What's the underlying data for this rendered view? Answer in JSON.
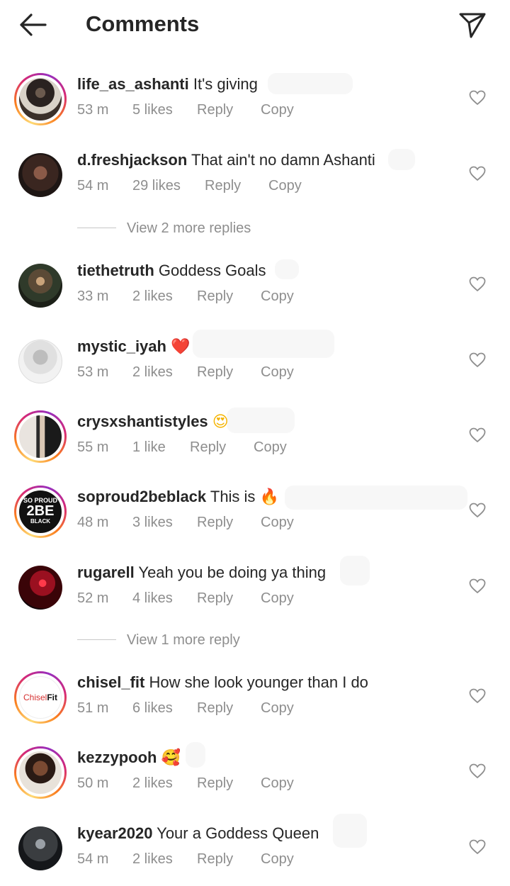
{
  "header": {
    "title": "Comments"
  },
  "comments": [
    {
      "username": "life_as_ashanti",
      "text": "It's giving",
      "time": "53 m",
      "likes": "5 likes",
      "reply": "Reply",
      "copy": "Copy"
    },
    {
      "username": "d.freshjackson",
      "text": "That ain't no damn Ashanti",
      "time": "54 m",
      "likes": "29 likes",
      "reply": "Reply",
      "copy": "Copy"
    },
    {
      "username": "tiethetruth",
      "text": "Goddess Goals",
      "time": "33 m",
      "likes": "2 likes",
      "reply": "Reply",
      "copy": "Copy"
    },
    {
      "username": "mystic_iyah",
      "text": "❤️",
      "time": "53 m",
      "likes": "2 likes",
      "reply": "Reply",
      "copy": "Copy"
    },
    {
      "username": "crysxshantistyles",
      "text": "😍",
      "time": "55 m",
      "likes": "1 like",
      "reply": "Reply",
      "copy": "Copy"
    },
    {
      "username": "soproud2beblack",
      "text": "This is 🔥",
      "time": "48 m",
      "likes": "3 likes",
      "reply": "Reply",
      "copy": "Copy"
    },
    {
      "username": "rugarell",
      "text": "Yeah you be doing ya thing",
      "time": "52 m",
      "likes": "4 likes",
      "reply": "Reply",
      "copy": "Copy"
    },
    {
      "username": "chisel_fit",
      "text": "How she look younger than I do",
      "time": "51 m",
      "likes": "6 likes",
      "reply": "Reply",
      "copy": "Copy"
    },
    {
      "username": "kezzypooh",
      "text": "🥰",
      "time": "50 m",
      "likes": "2 likes",
      "reply": "Reply",
      "copy": "Copy"
    },
    {
      "username": "kyear2020",
      "text": "Your a Goddess Queen",
      "time": "54 m",
      "likes": "2 likes",
      "reply": "Reply",
      "copy": "Copy"
    }
  ],
  "view_more": [
    {
      "label": "View 2 more replies"
    },
    {
      "label": "View 1 more reply"
    }
  ],
  "logos": {
    "soproud": {
      "line1": "SO PROUD",
      "line2": "2BE",
      "line3": "BLACK"
    },
    "chiselfit": {
      "part1": "Chisel",
      "part2": "Fit"
    }
  },
  "colors": {
    "text": "#262626",
    "meta": "#8e8e8e",
    "ring_start": "#feda75",
    "ring_end": "#962fbf"
  }
}
